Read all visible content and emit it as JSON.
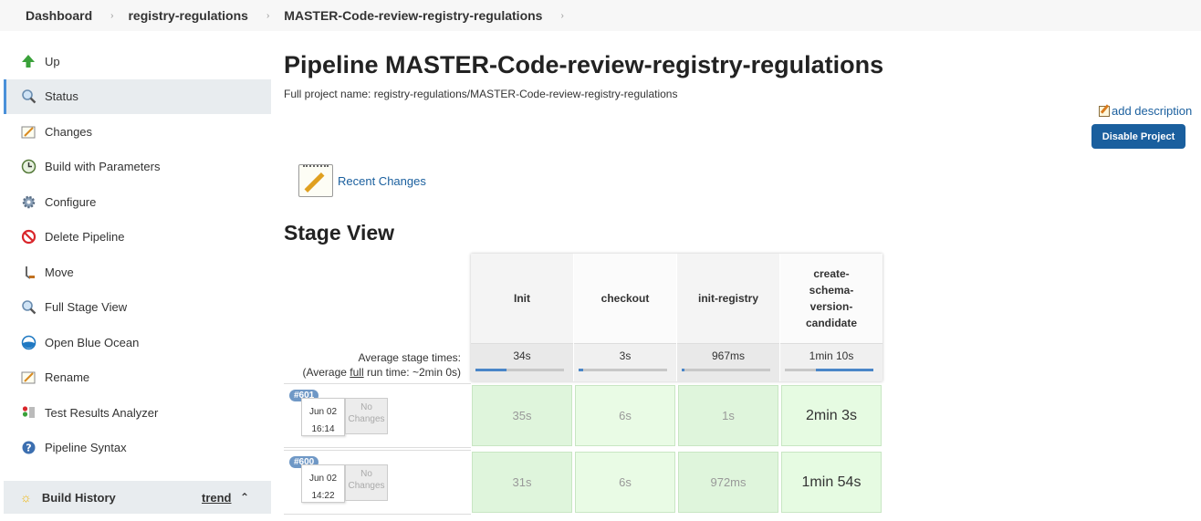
{
  "breadcrumb": [
    "Dashboard",
    "registry-regulations",
    "MASTER-Code-review-registry-regulations"
  ],
  "sidebar": {
    "items": [
      {
        "label": "Up",
        "icon": "up-arrow-icon"
      },
      {
        "label": "Status",
        "icon": "magnifier-icon",
        "active": true
      },
      {
        "label": "Changes",
        "icon": "notepad-icon"
      },
      {
        "label": "Build with Parameters",
        "icon": "clock-build-icon"
      },
      {
        "label": "Configure",
        "icon": "gear-icon"
      },
      {
        "label": "Delete Pipeline",
        "icon": "no-entry-icon"
      },
      {
        "label": "Move",
        "icon": "move-icon"
      },
      {
        "label": "Full Stage View",
        "icon": "magnifier-icon"
      },
      {
        "label": "Open Blue Ocean",
        "icon": "blue-ocean-icon"
      },
      {
        "label": "Rename",
        "icon": "notepad-icon"
      },
      {
        "label": "Test Results Analyzer",
        "icon": "traffic-light-icon"
      },
      {
        "label": "Pipeline Syntax",
        "icon": "help-icon"
      }
    ],
    "build_history": {
      "label": "Build History",
      "trend": "trend"
    }
  },
  "main": {
    "title": "Pipeline MASTER-Code-review-registry-regulations",
    "full_name": "Full project name: registry-regulations/MASTER-Code-review-registry-regulations",
    "add_description": "add description",
    "disable_button": "Disable Project",
    "recent_changes": "Recent Changes",
    "stage_view_title": "Stage View"
  },
  "stage_view": {
    "stages": [
      "Init",
      "checkout",
      "init-registry",
      "create-\nschema-\nversion-\ncandidate"
    ],
    "avg_label_line1": "Average stage times:",
    "avg_label_line2_pre": "(Average ",
    "avg_label_line2_u": "full",
    "avg_label_line2_post": " run time: ~2min 0s)",
    "avg_times": [
      "34s",
      "3s",
      "967ms",
      "1min 10s"
    ],
    "avg_fraction": [
      0.35,
      0.05,
      0.03,
      0.65
    ],
    "runs": [
      {
        "id": "#601",
        "date": "Jun 02",
        "time": "16:14",
        "changes": "No Changes",
        "durations": [
          "35s",
          "6s",
          "1s",
          "2min 3s"
        ]
      },
      {
        "id": "#600",
        "date": "Jun 02",
        "time": "14:22",
        "changes": "No Changes",
        "durations": [
          "31s",
          "6s",
          "972ms",
          "1min 54s"
        ]
      }
    ]
  },
  "colors": {
    "accent": "#1a5f9e",
    "success_cell": "#dff5dc",
    "active_bar": "#4a86c8"
  }
}
